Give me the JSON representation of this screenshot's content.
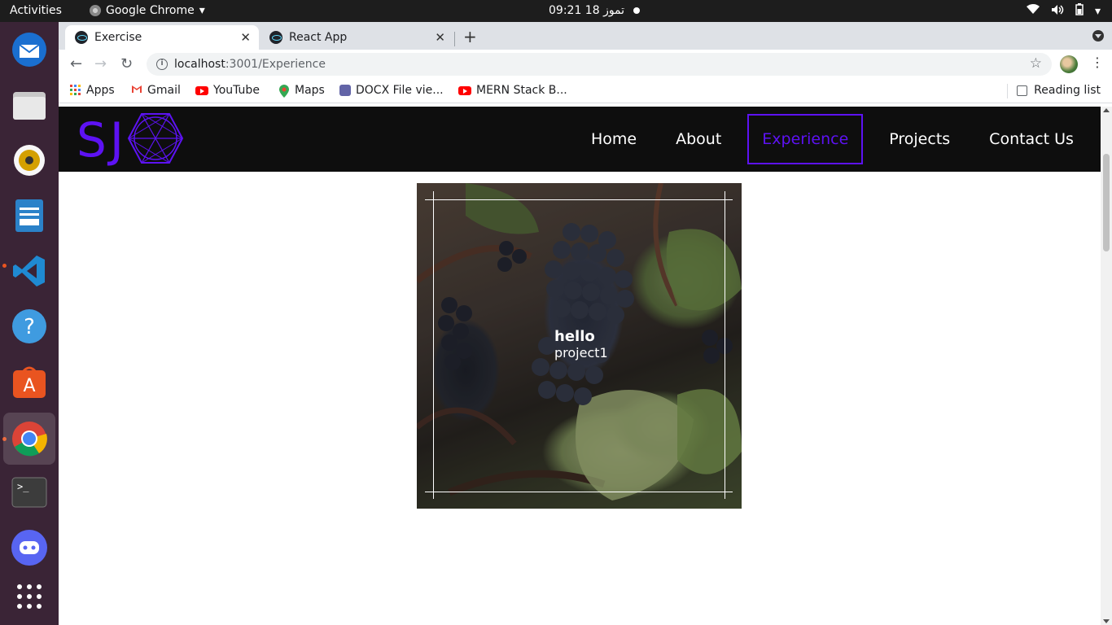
{
  "system": {
    "activities_label": "Activities",
    "app_name": "Google Chrome",
    "clock": "09:21  18 تموز"
  },
  "browser": {
    "tabs": [
      {
        "title": "Exercise",
        "active": true
      },
      {
        "title": "React App",
        "active": false
      }
    ],
    "url_host": "localhost",
    "url_path": ":3001/Experience",
    "bookmarks": [
      {
        "label": "Apps",
        "icon": "apps-grid-icon"
      },
      {
        "label": "Gmail",
        "icon": "gmail-icon"
      },
      {
        "label": "YouTube",
        "icon": "youtube-icon"
      },
      {
        "label": "Maps",
        "icon": "maps-icon"
      },
      {
        "label": "DOCX File vie...",
        "icon": "teams-icon"
      },
      {
        "label": "MERN Stack B...",
        "icon": "youtube-icon"
      }
    ],
    "reading_list": "Reading list"
  },
  "site": {
    "logo_text": "SJ",
    "nav": [
      {
        "label": "Home",
        "active": false
      },
      {
        "label": "About",
        "active": false
      },
      {
        "label": "Experience",
        "active": true
      },
      {
        "label": "Projects",
        "active": false
      },
      {
        "label": "Contact Us",
        "active": false
      }
    ],
    "accent_color": "#5d12f3",
    "card": {
      "title": "hello",
      "subtitle": "project1",
      "image_subject": "grapes on vine"
    }
  }
}
